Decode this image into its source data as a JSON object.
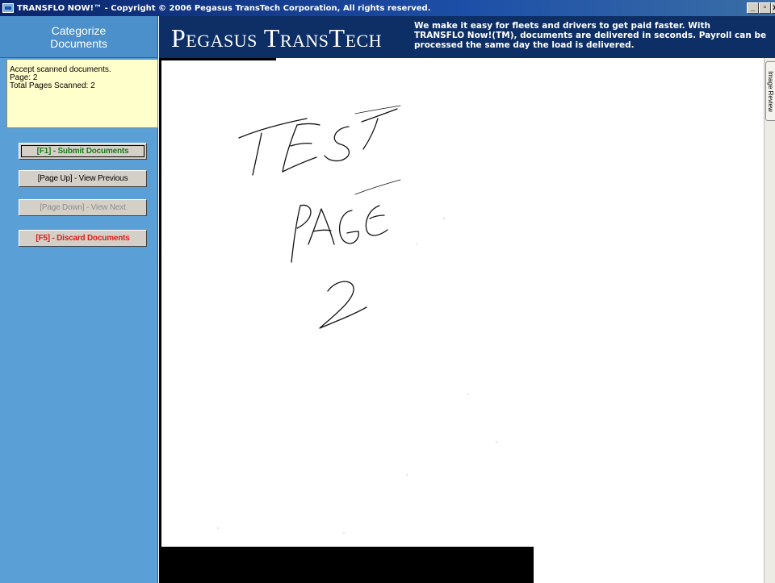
{
  "window": {
    "title": "TRANSFLO NOW!™ - Copyright © 2006 Pegasus TransTech Corporation, All rights reserved.",
    "min_label": "_",
    "max_label": "▫",
    "close_label": "x"
  },
  "sidebar": {
    "header_line1": "Categorize",
    "header_line2": "Documents",
    "info": {
      "line1": "Accept scanned documents.",
      "line2": "Page: 2",
      "line3": "Total Pages Scanned: 2"
    },
    "buttons": {
      "submit": "[F1] - Submit Documents",
      "prev": "[Page Up] - View Previous",
      "next": "[Page Down] - View Next",
      "discard": "[F5] - Discard Documents"
    }
  },
  "banner": {
    "brand": "Pegasus TransTech",
    "tagline_line1": "We make it easy for fleets and drivers to get paid faster. With",
    "tagline_line2": "TRANSFLO Now!(TM), documents are delivered in seconds. Payroll can be",
    "tagline_line3": "processed the same day the load is delivered."
  },
  "document": {
    "handwriting": [
      "TEST",
      "PAGE",
      "2"
    ]
  },
  "right_tab": {
    "label": "Image Review"
  },
  "colors": {
    "sidebar": "#5a9fd6",
    "banner": "#0d2f66",
    "info_box": "#ffffcc",
    "submit_text": "#1a7a1a",
    "discard_text": "#e01a1a"
  }
}
